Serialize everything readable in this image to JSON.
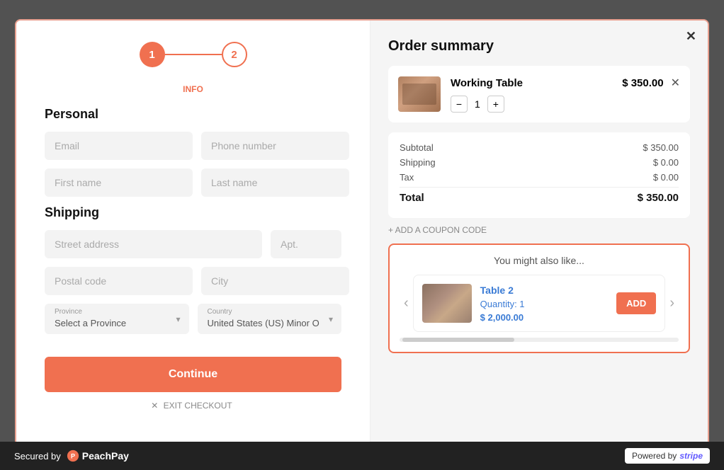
{
  "modal": {
    "close_button": "✕"
  },
  "stepper": {
    "step1_label": "1",
    "step2_label": "2",
    "info_label": "INFO"
  },
  "personal_section": {
    "title": "Personal",
    "email_placeholder": "Email",
    "phone_placeholder": "Phone number",
    "firstname_placeholder": "First name",
    "lastname_placeholder": "Last name"
  },
  "shipping_section": {
    "title": "Shipping",
    "street_placeholder": "Street address",
    "apt_placeholder": "Apt.",
    "postal_placeholder": "Postal code",
    "city_placeholder": "City",
    "province_label": "Province",
    "province_placeholder": "Select a Province",
    "country_label": "Country",
    "country_value": "United States (US) Minor O"
  },
  "continue_button": "Continue",
  "exit_checkout": "EXIT CHECKOUT",
  "order_summary": {
    "title": "Order summary",
    "item": {
      "name": "Working Table",
      "price": "$ 350.00",
      "quantity": "1"
    },
    "subtotal_label": "Subtotal",
    "subtotal_value": "$ 350.00",
    "shipping_label": "Shipping",
    "shipping_value": "$ 0.00",
    "tax_label": "Tax",
    "tax_value": "$ 0.00",
    "total_label": "Total",
    "total_value": "$ 350.00",
    "coupon_label": "+ ADD A COUPON CODE"
  },
  "upsell": {
    "title": "You might also like...",
    "item_name": "Table 2",
    "item_qty": "Quantity: 1",
    "item_price": "$ 2,000.00",
    "add_button": "ADD"
  },
  "bottom_bar": {
    "secured_text": "Secured by",
    "brand_name": "PeachPay",
    "powered_text": "Powered by",
    "stripe_text": "stripe"
  }
}
